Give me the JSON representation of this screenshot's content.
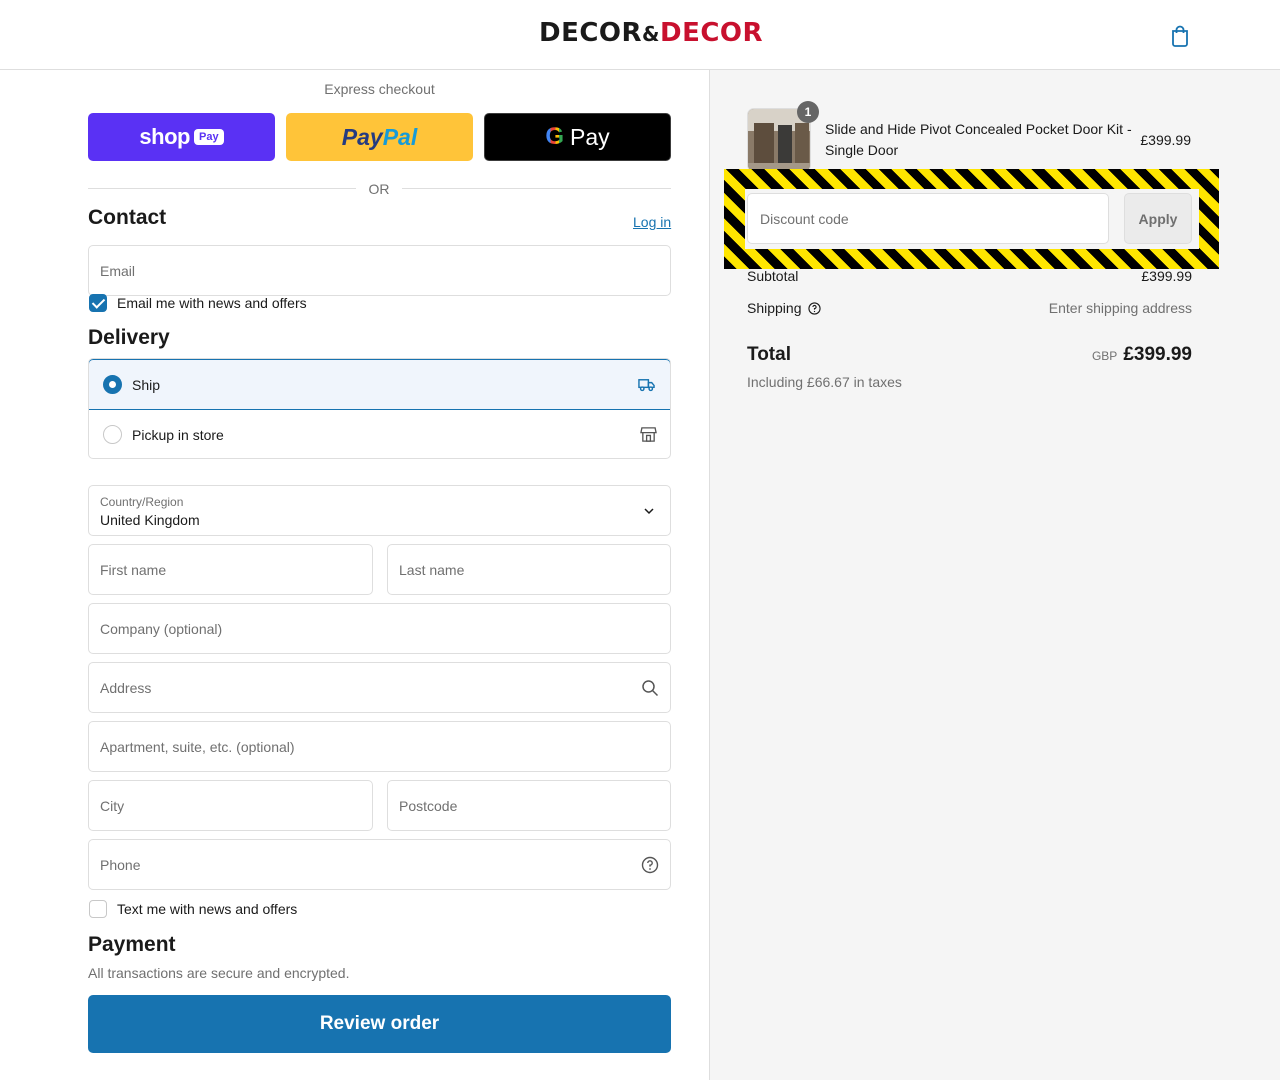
{
  "header": {
    "logo_part1": "DECOR",
    "logo_amp": "&",
    "logo_part2": "DECOR",
    "cart_icon": "shopping-bag-icon"
  },
  "express": {
    "label": "Express checkout",
    "shop_pay": {
      "text": "shop",
      "pill": "Pay"
    },
    "paypal": {
      "part1": "Pay",
      "part2": "Pal"
    },
    "gpay": {
      "g": "G",
      "text": "Pay"
    },
    "or": "OR"
  },
  "contact": {
    "title": "Contact",
    "login": "Log in",
    "email_placeholder": "Email",
    "email_news": {
      "label": "Email me with news and offers",
      "checked": true
    }
  },
  "delivery": {
    "title": "Delivery",
    "options": [
      {
        "label": "Ship",
        "selected": true,
        "icon": "truck-icon"
      },
      {
        "label": "Pickup in store",
        "selected": false,
        "icon": "store-icon"
      }
    ],
    "country": {
      "label": "Country/Region",
      "value": "United Kingdom"
    },
    "first_name": "First name",
    "last_name": "Last name",
    "company": "Company (optional)",
    "address": "Address",
    "apartment": "Apartment, suite, etc. (optional)",
    "city": "City",
    "postcode": "Postcode",
    "phone": "Phone",
    "text_news": {
      "label": "Text me with news and offers",
      "checked": false
    }
  },
  "payment": {
    "title": "Payment",
    "subtitle": "All transactions are secure and encrypted.",
    "review_button": "Review order"
  },
  "summary": {
    "item": {
      "quantity": "1",
      "name": "Slide and Hide Pivot Concealed Pocket Door Kit - Single Door",
      "price": "£399.99"
    },
    "discount_placeholder": "Discount code",
    "apply": "Apply",
    "subtotal_label": "Subtotal",
    "subtotal_value": "£399.99",
    "shipping_label": "Shipping",
    "shipping_value": "Enter shipping address",
    "total_label": "Total",
    "currency": "GBP",
    "total_value": "£399.99",
    "taxes": "Including £66.67 in taxes"
  },
  "colors": {
    "accent": "#1773b0",
    "shop_pay": "#5a31f4",
    "paypal": "#ffc439",
    "brand_red": "#c8102e",
    "hazard_yellow": "#ffe600"
  }
}
